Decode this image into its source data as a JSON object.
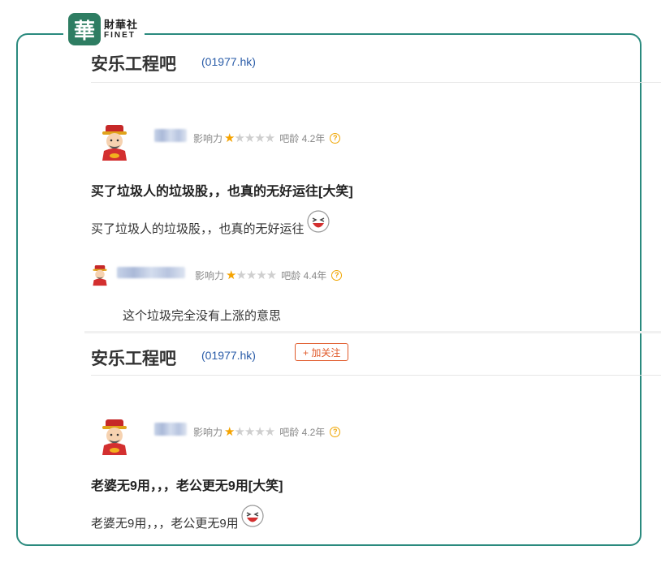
{
  "brand": {
    "glyph": "華",
    "name_cn": "財華社",
    "name_en": "FINET"
  },
  "sections": [
    {
      "bar_name": "安乐工程吧",
      "bar_code": "(01977.hk)",
      "post": {
        "meta": {
          "influence_label": "影响力",
          "stars_filled": 1,
          "stars_total": 5,
          "age_label": "吧龄 4.2年",
          "help": "?"
        },
        "title": "买了垃圾人的垃圾股，，也真的无好运往[大笑]",
        "body": "买了垃圾人的垃圾股，，也真的无好运往",
        "emoji_icon": "laughing-face-icon"
      },
      "reply": {
        "meta": {
          "influence_label": "影响力",
          "stars_filled": 1,
          "stars_total": 5,
          "age_label": "吧龄 4.4年",
          "help": "?"
        },
        "text": "这个垃圾完全没有上涨的意思"
      }
    },
    {
      "bar_name": "安乐工程吧",
      "bar_code": "(01977.hk)",
      "follow_button": "+ 加关注",
      "post": {
        "meta": {
          "influence_label": "影响力",
          "stars_filled": 1,
          "stars_total": 5,
          "age_label": "吧龄 4.2年",
          "help": "?"
        },
        "title": "老婆无9用，，，老公更无9用[大笑]",
        "body": "老婆无9用，，，老公更无9用",
        "emoji_icon": "laughing-face-icon"
      }
    }
  ],
  "colors": {
    "frame": "#2a8a7e",
    "logo": "#2e7d62",
    "star": "#f5a300",
    "follow": "#e05a2a",
    "code": "#2a5ca8"
  }
}
